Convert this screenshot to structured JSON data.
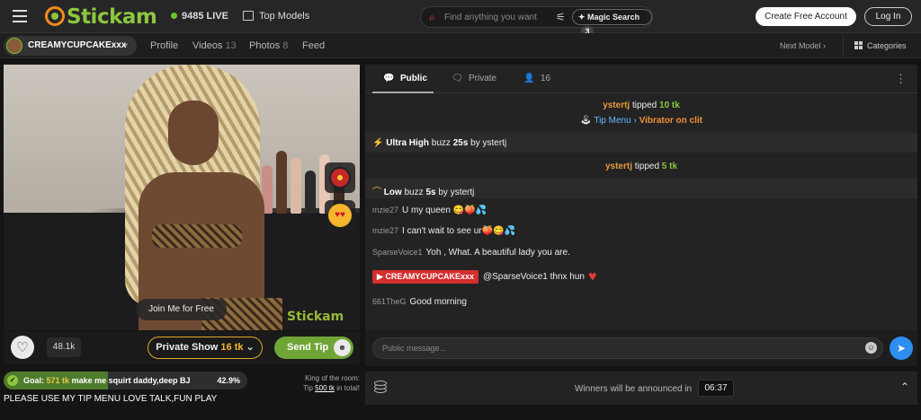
{
  "header": {
    "logo": "Stickam",
    "live_count": "9485 LIVE",
    "top_models": "Top Models",
    "search_placeholder": "Find anything you want",
    "magic_search": "Magic Search",
    "magic_count": "3",
    "create_account": "Create Free Account",
    "login": "Log In"
  },
  "subnav": {
    "model_name": "CREAMYCUPCAKExxx",
    "profile": "Profile",
    "videos": "Videos",
    "videos_count": "13",
    "photos": "Photos",
    "photos_count": "8",
    "feed": "Feed",
    "next_model": "Next Model",
    "categories": "Categories"
  },
  "video": {
    "watermark": "Stickam",
    "join_free": "Join Me for Free"
  },
  "controls": {
    "likes": "48.1k",
    "private_show": "Private Show",
    "private_price": "16 tk",
    "send_tip": "Send Tip"
  },
  "goal": {
    "label": "Goal:",
    "tokens": "571 tk",
    "text": "make me squirt daddy,deep BJ",
    "percent_text": "42.9%",
    "progress": 0.429
  },
  "king": {
    "line1": "King of the room:",
    "tip_label": "Tip",
    "amount": "500 tk",
    "suffix": "in total!"
  },
  "topic": "PLEASE USE MY TIP MENU LOVE TALK,FUN PLAY",
  "chat": {
    "tabs": {
      "public": "Public",
      "private": "Private",
      "users": "16"
    },
    "messages": {
      "m1_user": "ystertj",
      "m1_verb": "tipped",
      "m1_amount": "10 tk",
      "m2_menu": "Tip Menu",
      "m2_item": "Vibrator on clit",
      "m3_level": "Ultra High",
      "m3_buzz": "buzz",
      "m3_dur": "25s",
      "m3_by": "by ystertj",
      "m4_user": "ystertj",
      "m4_verb": "tipped",
      "m4_amount": "5 tk",
      "m5_level": "Low",
      "m5_buzz": "buzz",
      "m5_dur": "5s",
      "m5_by": "by ystertj",
      "m6_user": "mzie27",
      "m6_text": "U my queen 😋🍑💦",
      "m7_user": "mzie27",
      "m7_text": "I can't wait to see ur🍑😋💦",
      "m8_user": "SparseVoice1",
      "m8_text": "Yoh , What. A beautiful lady you are.",
      "m9_model": "CREAMYCUPCAKExxx",
      "m9_text": "@SparseVoice1 thnx hun",
      "m10_user": "661TheG",
      "m10_text": "Good morning"
    },
    "input_placeholder": "Public message..."
  },
  "winners": {
    "text": "Winners will be announced in",
    "timer": "06:37"
  }
}
